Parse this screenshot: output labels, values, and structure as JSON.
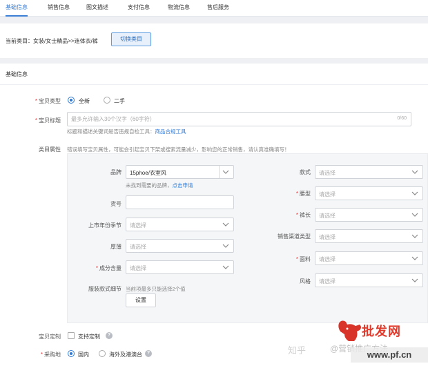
{
  "tabs": [
    "基础信息",
    "销售信息",
    "图文描述",
    "支付信息",
    "物流信息",
    "售后服务"
  ],
  "category": {
    "label": "当前类目：女装/女士精品>>连体衣/裤",
    "switch_button": "切换类目"
  },
  "section": {
    "title": "基础信息"
  },
  "item_type": {
    "label": "宝贝类型",
    "options": [
      "全新",
      "二手"
    ],
    "selected": "全新"
  },
  "item_title": {
    "label": "宝贝标题",
    "placeholder": "最多允许输入30个汉字（60字符）",
    "count": "0/60",
    "hint": "标题和描述关键词是否违规自检工具：",
    "hint_link": "商品合规工具"
  },
  "attributes": {
    "label": "类目属性",
    "warning": "错误填写宝贝属性，可能会引起宝贝下架或搜索流量减少，影响您的正常销售，请认真准确填写！",
    "brand": {
      "label": "品牌",
      "value": "15phoe/衣室风",
      "hint": "未找到需要的品牌，",
      "hint_link": "点击申请"
    },
    "model": {
      "label": "货号"
    },
    "season": {
      "label": "上市年份季节",
      "placeholder": "请选择"
    },
    "thickness": {
      "label": "厚薄",
      "placeholder": "请选择"
    },
    "composition": {
      "label": "成分含量",
      "placeholder": "请选择"
    },
    "style_detail": {
      "label": "服装款式细节",
      "hint": "当前项最多只能选择2个值",
      "button": "设置"
    },
    "style_type": {
      "label": "款式",
      "placeholder": "请选择"
    },
    "waist": {
      "label": "腰型",
      "placeholder": "请选择"
    },
    "pants_length": {
      "label": "裤长",
      "placeholder": "请选择"
    },
    "channel": {
      "label": "销售渠道类型",
      "placeholder": "请选择"
    },
    "fabric": {
      "label": "面料",
      "placeholder": "请选择"
    },
    "style": {
      "label": "风格",
      "placeholder": "请选择"
    }
  },
  "customization": {
    "label": "宝贝定制",
    "option": "支持定制"
  },
  "origin": {
    "label": "采购地",
    "options": [
      "国内",
      "海外及港澳台"
    ],
    "selected": "国内"
  },
  "watermarks": {
    "zhihu": "知乎",
    "overlay": "@营销推广方法",
    "site": "www.pf.cn",
    "brand": "批发网"
  },
  "colors": {
    "accent": "#3a7fd5",
    "required": "#e5373b",
    "brand_red": "#e03a2c"
  }
}
